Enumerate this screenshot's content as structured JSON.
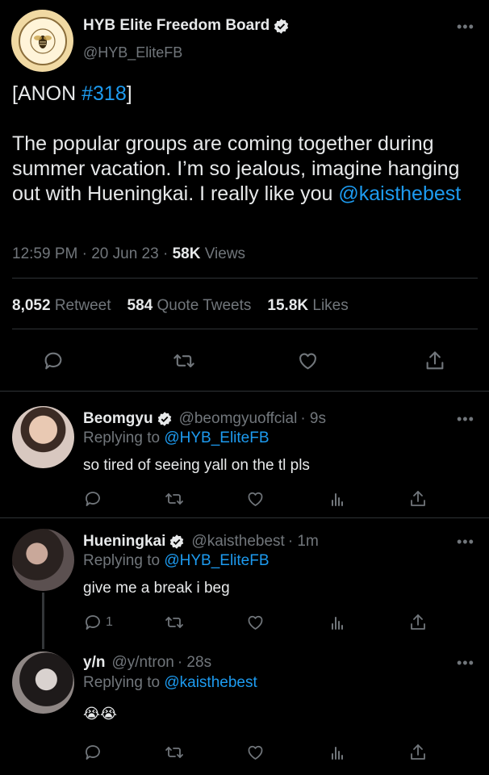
{
  "tweet": {
    "author_name": "HYB Elite Freedom Board",
    "handle": "@HYB_EliteFB",
    "text_prefix": "[ANON ",
    "hashtag": "#318",
    "text_suffix": "]",
    "body": "The popular groups are coming together during summer vacation. I’m so jealous, imagine hanging out with Hueningkai. I really like you ",
    "mention": "@kaisthebest",
    "time": "12:59 PM",
    "sep": "·",
    "date": "20 Jun 23",
    "views_count": "58K",
    "views_label": "Views",
    "stats": {
      "retweets_count": "8,052",
      "retweets_label": "Retweet",
      "quotes_count": "584",
      "quotes_label": "Quote Tweets",
      "likes_count": "15.8K",
      "likes_label": "Likes"
    }
  },
  "replies": [
    {
      "name": "Beomgyu",
      "handle": "@beomgyuoffcial",
      "time": "· 9s",
      "replying_label": "Replying to",
      "replying_to": "@HYB_EliteFB",
      "text": "so tired of seeing yall on the tl pls",
      "reply_count": ""
    },
    {
      "name": "Hueningkai",
      "handle": "@kaisthebest",
      "time": "· 1m",
      "replying_label": "Replying to",
      "replying_to": "@HYB_EliteFB",
      "text": "give me a break i beg",
      "reply_count": "1"
    },
    {
      "name": "y/n",
      "handle": "@y/ntron",
      "time": "· 28s",
      "replying_label": "Replying to",
      "replying_to": "@kaisthebest",
      "text": "😭😭",
      "reply_count": ""
    }
  ],
  "icons": {
    "verified": "verified-badge-icon",
    "more": "more-icon",
    "reply": "reply-icon",
    "retweet": "retweet-icon",
    "like": "heart-icon",
    "views": "views-icon",
    "share": "share-icon"
  },
  "colors": {
    "background": "#000000",
    "text": "#e7e9ea",
    "muted": "#71767b",
    "link": "#1d9bf0",
    "divider": "#2f3336"
  }
}
